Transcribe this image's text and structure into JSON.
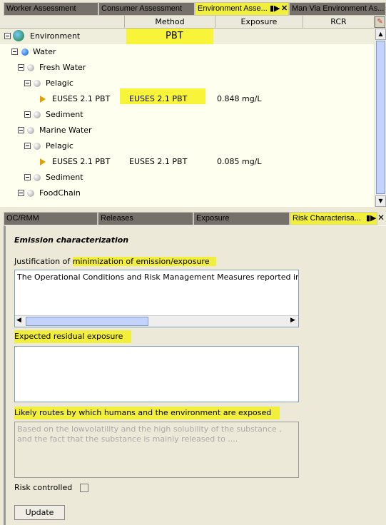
{
  "top_tabs": [
    {
      "label": "Worker Assessment"
    },
    {
      "label": "Consumer Assessment"
    },
    {
      "label": "Environment Asse..."
    },
    {
      "label": "Man Via Environment As..."
    }
  ],
  "columns": {
    "method": "Method",
    "exposure": "Exposure",
    "rcr": "RCR"
  },
  "tree": [
    {
      "label": "Environment",
      "method": "PBT",
      "exposure": "",
      "icon": "globe-icon"
    },
    {
      "label": "Water",
      "icon": "blue-ball-icon"
    },
    {
      "label": "Fresh Water",
      "icon": "gray-ball-icon"
    },
    {
      "label": "Pelagic",
      "icon": "gray-ball-icon"
    },
    {
      "label": "EUSES 2.1 PBT",
      "method": "EUSES 2.1 PBT",
      "exposure": "0.848 mg/L",
      "icon": "arrow-icon"
    },
    {
      "label": "Sediment",
      "icon": "gray-ball-icon"
    },
    {
      "label": "Marine Water",
      "icon": "gray-ball-icon"
    },
    {
      "label": "Pelagic",
      "icon": "gray-ball-icon"
    },
    {
      "label": "EUSES 2.1 PBT",
      "method": "EUSES 2.1 PBT",
      "exposure": "0.085 mg/L",
      "icon": "arrow-icon"
    },
    {
      "label": "Sediment",
      "icon": "gray-ball-icon"
    },
    {
      "label": "FoodChain",
      "icon": "gray-ball-icon"
    }
  ],
  "bottom_tabs": [
    {
      "label": "OC/RMM"
    },
    {
      "label": "Releases"
    },
    {
      "label": "Exposure"
    },
    {
      "label": "Risk Characterisa..."
    }
  ],
  "panel": {
    "title": "Emission characterization",
    "justification_prefix": "Justification of ",
    "justification_highlight": "minimization of emission/exposure",
    "justification_text": "The Operational Conditions and Risk Management Measures reported in the",
    "residual_label": "Expected residual exposure",
    "residual_text": "",
    "routes_label": "Likely routes by which humans and the environment are exposed",
    "routes_placeholder": "Based on the lowvolatility and the high solubility of the substance , and the fact that the substance is mainly released to ....",
    "risk_controlled_label": "Risk controlled",
    "risk_controlled": false,
    "update_label": "Update"
  },
  "colors": {
    "highlight": "#f2ee3c",
    "tree_bg": "#fffff0",
    "tab_bg": "#757069"
  }
}
